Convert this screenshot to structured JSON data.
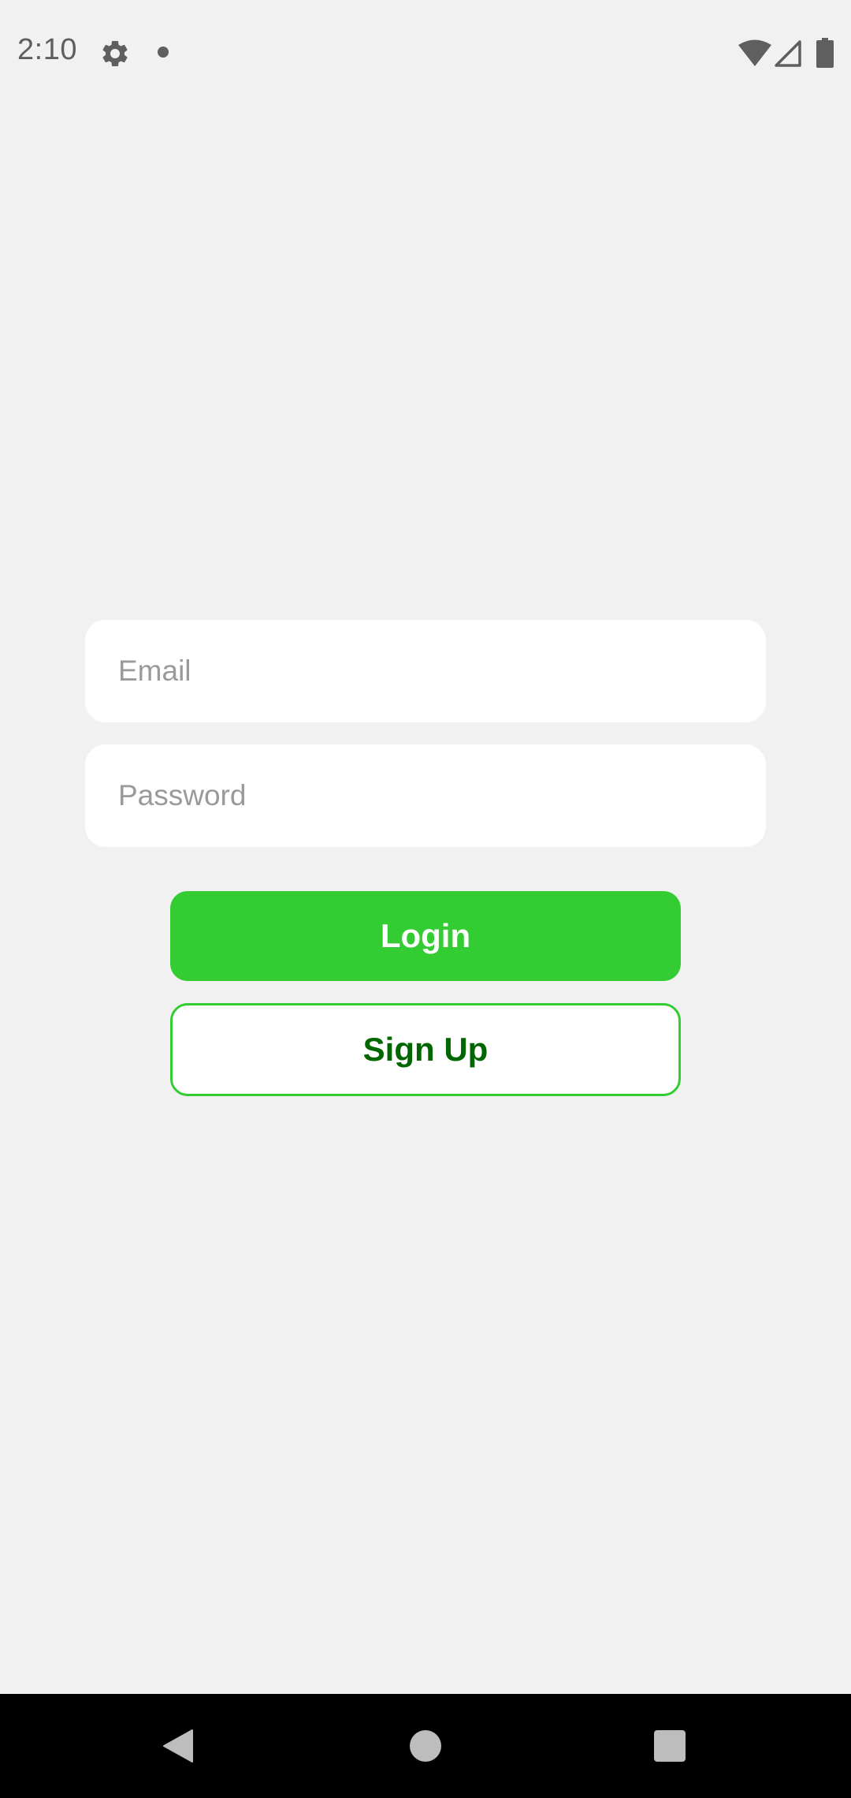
{
  "status_bar": {
    "time": "2:10",
    "icons": [
      "gear-icon",
      "notification-dot-icon",
      "wifi-icon",
      "signal-icon",
      "battery-icon"
    ]
  },
  "login_form": {
    "email_placeholder": "Email",
    "email_value": "",
    "password_placeholder": "Password",
    "password_value": "",
    "login_label": "Login",
    "signup_label": "Sign Up"
  },
  "nav_bar": {
    "icons": [
      "back-icon",
      "home-icon",
      "recents-icon"
    ]
  },
  "colors": {
    "background": "#f1f1f1",
    "accent_green": "#33cc33",
    "signup_text": "#006600",
    "status_icons": "#5f5f5f"
  }
}
